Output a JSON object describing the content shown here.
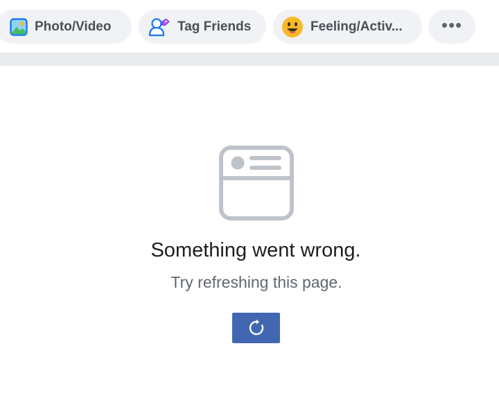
{
  "composer": {
    "photo_label": "Photo/Video",
    "photo_icon": "photo-icon",
    "tag_label": "Tag Friends",
    "tag_icon": "tag-friends-icon",
    "feeling_label": "Feeling/Activ...",
    "feeling_icon": "smiley-icon",
    "more_label": "•••",
    "more_icon": "more-icon"
  },
  "error": {
    "icon": "feed-placeholder-icon",
    "title": "Something went wrong.",
    "subtitle": "Try refreshing this page.",
    "refresh_icon": "refresh-icon"
  },
  "colors": {
    "button_blue": "#4267b2",
    "pill_bg": "#f0f2f5",
    "divider_bg": "#e9ebee",
    "icon_gray": "#bec3c9"
  }
}
